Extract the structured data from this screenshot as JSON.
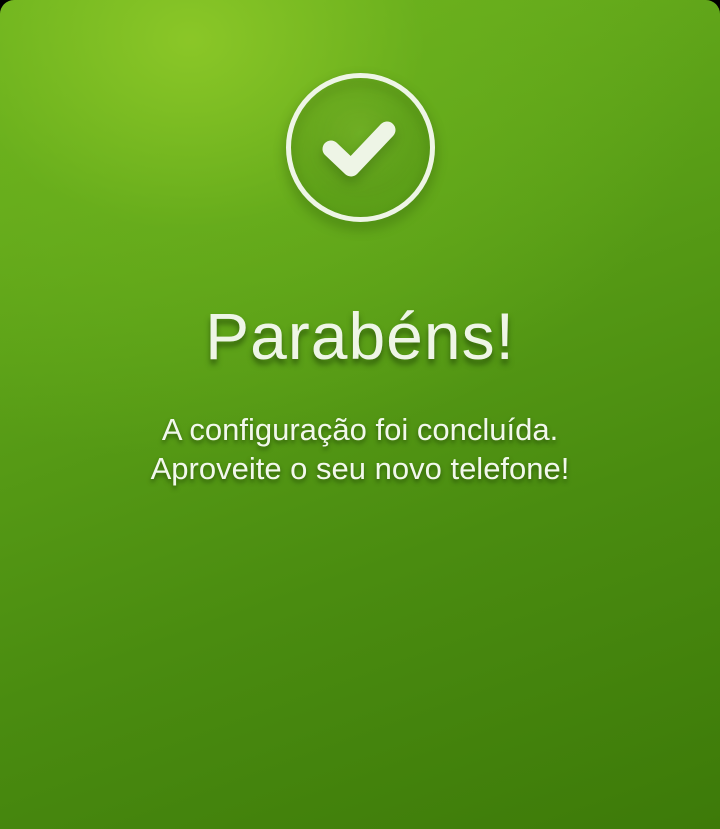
{
  "completion_screen": {
    "icon": "check-circle-icon",
    "title": "Parabéns!",
    "message_line_1": "A configuração foi concluída.",
    "message_line_2": "Aproveite o seu novo telefone!"
  },
  "colors": {
    "background_light": "#7cbf22",
    "background_dark": "#3d7a09",
    "text": "#eef5e6"
  }
}
